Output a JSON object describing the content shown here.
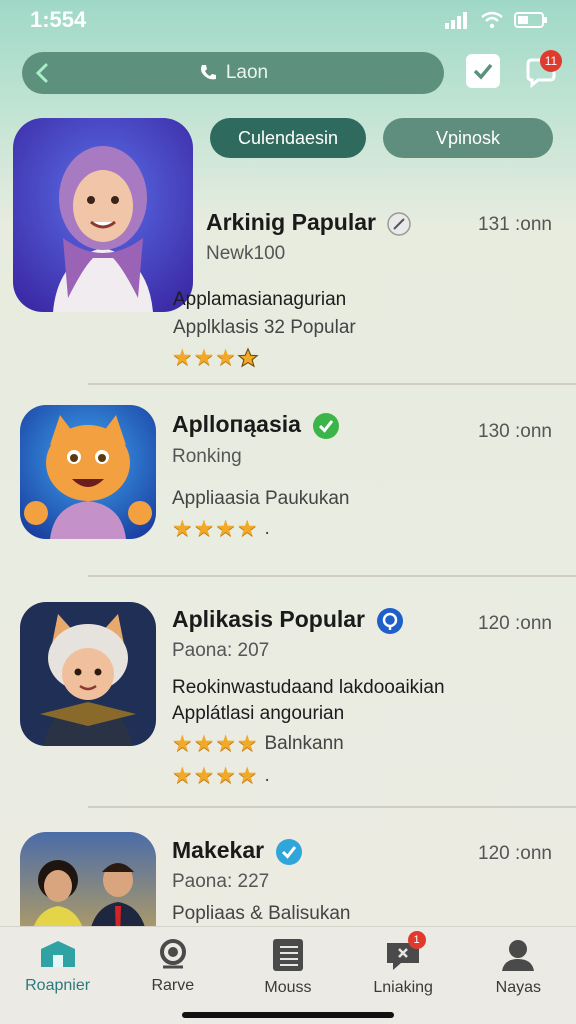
{
  "status_bar": {
    "time": "1:554"
  },
  "search": {
    "label": "Laon"
  },
  "header": {
    "chat_badge": "11"
  },
  "tabs": [
    {
      "label": "Culendaesin"
    },
    {
      "label": "Vpinosk"
    }
  ],
  "apps": [
    {
      "name": "Arkinig Papular",
      "badge_icon": "clock-icon",
      "subtitle": "Newk100",
      "time": "131 :onn",
      "desc1": "Applamasianagurian",
      "desc2": "Applklasis 32 Popular",
      "rating": 3.5,
      "rating_extra": ""
    },
    {
      "name": "Aplloпąasia",
      "badge_icon": "green-check-icon",
      "subtitle": "Ronking",
      "time": "130 :onn",
      "desc1": "Appliaasia Paukukan",
      "desc2": "",
      "rating": 4,
      "rating_extra": "."
    },
    {
      "name": "Aplikasis Popular",
      "badge_icon": "blue-badge-icon",
      "subtitle": "Paona: 207",
      "time": "120 :onn",
      "desc1": "Reokinwastudaand lakdooaikian",
      "desc2": "Applátlasi angourian",
      "rating": 4,
      "rating_extra": "Balnkann",
      "rating2": 4,
      "rating2_extra": "."
    },
    {
      "name": "Makekar",
      "badge_icon": "blue-check-icon",
      "subtitle": "Paona: 227",
      "time": "120 :onn",
      "desc1": "Popliaas & Balisukan"
    }
  ],
  "bottom_nav": [
    {
      "label": "Roapnier",
      "icon": "home-icon",
      "active": true
    },
    {
      "label": "Rarve",
      "icon": "search-icon"
    },
    {
      "label": "Mouss",
      "icon": "document-icon"
    },
    {
      "label": "Lniaking",
      "icon": "message-icon",
      "badge": "1"
    },
    {
      "label": "Nayas",
      "icon": "profile-icon"
    }
  ],
  "colors": {
    "accent": "#2f6a5e",
    "star": "#f2a927",
    "badge": "#e03a2f"
  }
}
